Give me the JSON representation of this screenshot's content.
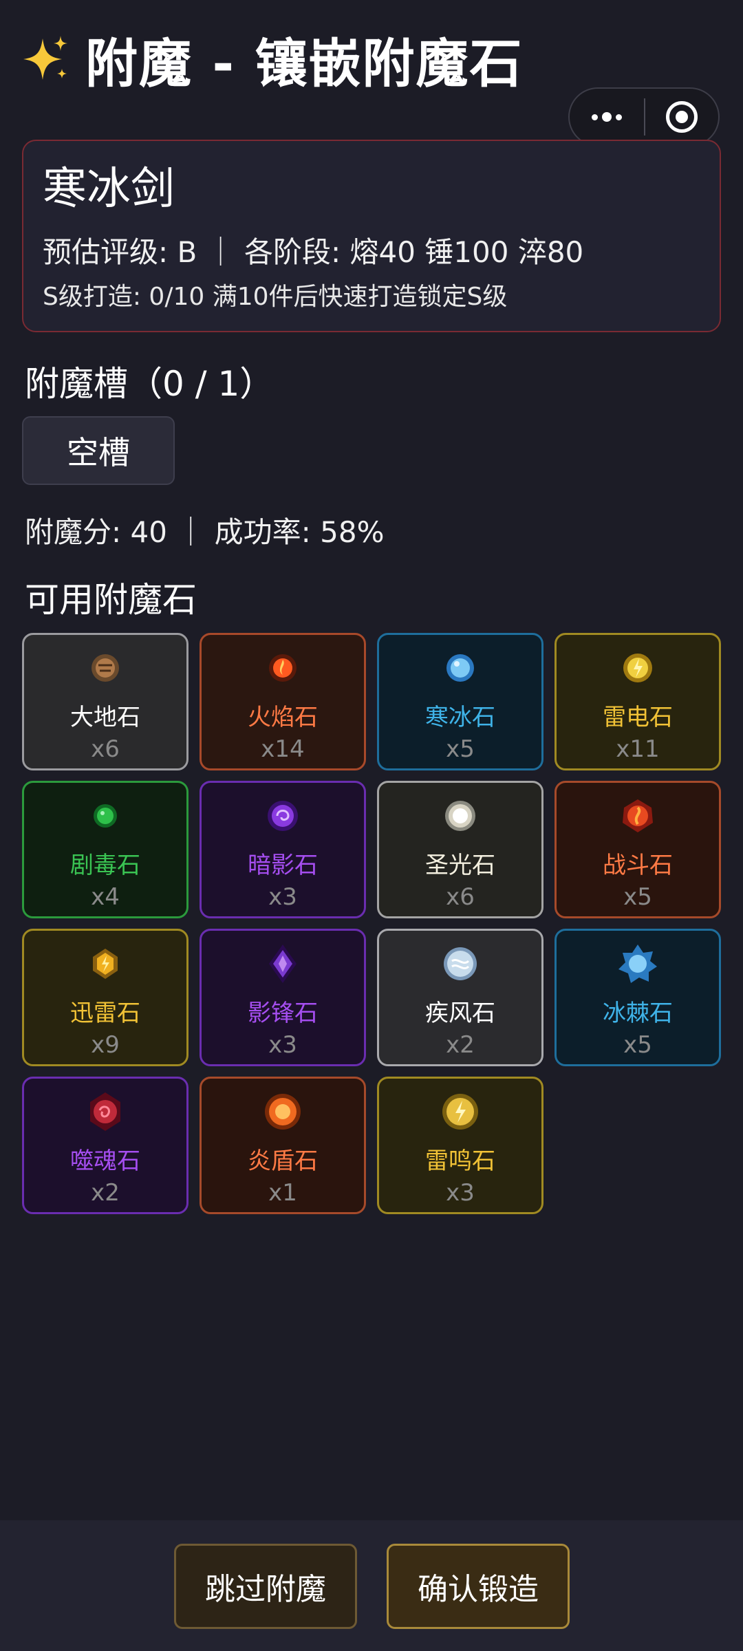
{
  "header": {
    "title": "附魔 - 镶嵌附魔石"
  },
  "item": {
    "name": "寒冰剑",
    "line1": "预估评级: B ｜ 各阶段: 熔40 锤100 淬80",
    "line2": "S级打造: 0/10  满10件后快速打造锁定S级"
  },
  "slots": {
    "title": "附魔槽（0 / 1）",
    "empty_label": "空槽"
  },
  "score": {
    "text": "附魔分: 40 ｜ 成功率: 58%"
  },
  "stones": {
    "title": "可用附魔石",
    "items": [
      {
        "name": "大地石",
        "count": "x6",
        "icon": "earth-stone-icon",
        "color": "#b07a4a"
      },
      {
        "name": "火焰石",
        "count": "x14",
        "icon": "fire-stone-icon",
        "color": "#ff5a20"
      },
      {
        "name": "寒冰石",
        "count": "x5",
        "icon": "ice-stone-icon",
        "color": "#5ab8f0"
      },
      {
        "name": "雷电石",
        "count": "x11",
        "icon": "thunder-stone-icon",
        "color": "#f0d040"
      },
      {
        "name": "剧毒石",
        "count": "x4",
        "icon": "poison-stone-icon",
        "color": "#2ec04a"
      },
      {
        "name": "暗影石",
        "count": "x3",
        "icon": "shadow-stone-icon",
        "color": "#8a3ae0"
      },
      {
        "name": "圣光石",
        "count": "x6",
        "icon": "holy-stone-icon",
        "color": "#f4f0e0"
      },
      {
        "name": "战斗石",
        "count": "x5",
        "icon": "battle-stone-icon",
        "color": "#e84a20"
      },
      {
        "name": "迅雷石",
        "count": "x9",
        "icon": "swift-thunder-stone-icon",
        "color": "#f0b020"
      },
      {
        "name": "影锋石",
        "count": "x3",
        "icon": "shadow-blade-stone-icon",
        "color": "#7a3ad0"
      },
      {
        "name": "疾风石",
        "count": "x2",
        "icon": "wind-stone-icon",
        "color": "#c8dcec"
      },
      {
        "name": "冰棘石",
        "count": "x5",
        "icon": "ice-thorn-stone-icon",
        "color": "#4aa8e8"
      },
      {
        "name": "噬魂石",
        "count": "x2",
        "icon": "soul-stone-icon",
        "color": "#c02a3a"
      },
      {
        "name": "炎盾石",
        "count": "x1",
        "icon": "flame-shield-stone-icon",
        "color": "#f06a20"
      },
      {
        "name": "雷鸣石",
        "count": "x3",
        "icon": "thunder-roar-stone-icon",
        "color": "#e8c040"
      }
    ]
  },
  "actions": {
    "skip": "跳过附魔",
    "confirm": "确认锻造"
  },
  "icons": {
    "title_icon": "sparkles-icon",
    "menu": "more-dots-icon",
    "close": "target-icon"
  }
}
